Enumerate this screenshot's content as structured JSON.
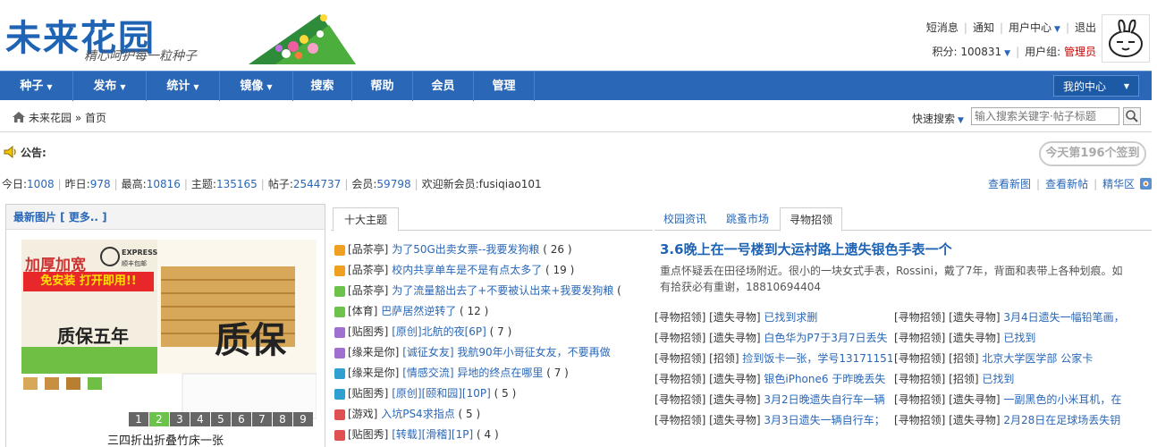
{
  "header": {
    "logo_title": "未来花园",
    "logo_slogan": "精心呵护每一粒种子",
    "links": [
      "短消息",
      "通知",
      "用户中心",
      "退出"
    ],
    "points_label": "积分: 100831",
    "group_label": "用户组:",
    "group_value": "管理员"
  },
  "nav": {
    "items": [
      "种子",
      "发布",
      "统计",
      "镜像",
      "搜索",
      "帮助",
      "会员",
      "管理"
    ],
    "my_center": "我的中心"
  },
  "breadcrumb": {
    "home": "未来花园",
    "sep": "»",
    "current": "首页"
  },
  "quick_search": {
    "label": "快速搜索",
    "placeholder": "输入搜索关键字·帖子标题"
  },
  "notice": {
    "label": "公告:"
  },
  "sign_button": "今天第196个签到",
  "stats": {
    "today_label": "今日:",
    "today": "1008",
    "yesterday_label": "昨日:",
    "yesterday": "978",
    "max_label": "最高:",
    "max": "10816",
    "topics_label": "主题:",
    "topics": "135165",
    "posts_label": "帖子:",
    "posts": "2544737",
    "members_label": "会员:",
    "members": "59798",
    "welcome": "欢迎新会员:fusiqiao101",
    "links": [
      "查看新图",
      "查看新帖",
      "精华区"
    ]
  },
  "latest_images": {
    "title": "最新图片 [ 更多.. ]",
    "caption": "三四折出折叠竹床一张",
    "pages": [
      "1",
      "2",
      "3",
      "4",
      "5",
      "6",
      "7",
      "8",
      "9"
    ],
    "active_page": 2,
    "ad_texts": [
      "加厚加宽",
      "EXPRESS",
      "顺丰包邮",
      "免安装 打开即用!!",
      "质保五年",
      "质保"
    ]
  },
  "top_topics": {
    "tab": "十大主题",
    "items": [
      {
        "forum": "[品茶亭]",
        "title": "为了50G出卖女票--我要发狗粮",
        "count": "( 26 )",
        "color": "#f0a020"
      },
      {
        "forum": "[品茶亭]",
        "title": "校内共享单车是不是有点太多了",
        "count": "( 19 )",
        "color": "#f0a020"
      },
      {
        "forum": "[品茶亭]",
        "title": "为了流量豁出去了+不要被认出来+我要发狗粮",
        "count": "(",
        "color": "#6cc24a"
      },
      {
        "forum": "[体育]",
        "title": "巴萨居然逆转了",
        "count": "( 12 )",
        "color": "#6cc24a"
      },
      {
        "forum": "[贴图秀]",
        "title": "[原创]北航的夜[6P]",
        "count": "( 7 )",
        "color": "#a070d0"
      },
      {
        "forum": "[缘来是你]",
        "title": "[诚征女友] 我航90年小哥征女友，不要再做",
        "count": "",
        "color": "#a070d0"
      },
      {
        "forum": "[缘来是你]",
        "title": "[情感交流] 异地的终点在哪里",
        "count": "( 7 )",
        "color": "#30a0d0"
      },
      {
        "forum": "[贴图秀]",
        "title": "[原创][颐和园][10P]",
        "count": "( 5 )",
        "color": "#30a0d0"
      },
      {
        "forum": "[游戏]",
        "title": "入坑PS4求指点",
        "count": "( 5 )",
        "color": "#e05050"
      },
      {
        "forum": "[贴图秀]",
        "title": "[转载][滑稽][1P]",
        "count": "( 4 )",
        "color": "#e05050"
      }
    ]
  },
  "right_panel": {
    "tabs": [
      "校园资讯",
      "跳蚤市场",
      "寻物招领"
    ],
    "active_tab": 2,
    "headline": "3.6晚上在一号楼到大运村路上遗失银色手表一个",
    "summary": "重点怀疑丢在田径场附近。很小的一块女式手表，Rossini，戴了7年，背面和表带上各种划痕。如有拾获必有重谢，18810694404",
    "rows": [
      [
        {
          "tag": "[寻物招领] [遗失寻物]",
          "title": "已找到求删"
        },
        {
          "tag": "[寻物招领] [遗失寻物]",
          "title": "3月4日遗失一幅铅笔画，"
        }
      ],
      [
        {
          "tag": "[寻物招领] [遗失寻物]",
          "title": "白色华为P7于3月7日丢失"
        },
        {
          "tag": "[寻物招领] [遗失寻物]",
          "title": "已找到"
        }
      ],
      [
        {
          "tag": "[寻物招领] [招领]",
          "title": "捡到饭卡一张，学号13171151"
        },
        {
          "tag": "[寻物招领] [招领]",
          "title": "北京大学医学部 公家卡"
        }
      ],
      [
        {
          "tag": "[寻物招领] [遗失寻物]",
          "title": "银色iPhone6 于昨晚丢失"
        },
        {
          "tag": "[寻物招领] [招领]",
          "title": "已找到"
        }
      ],
      [
        {
          "tag": "[寻物招领] [遗失寻物]",
          "title": "3月2日晚遗失自行车一辆"
        },
        {
          "tag": "[寻物招领] [遗失寻物]",
          "title": "一副黑色的小米耳机，在"
        }
      ],
      [
        {
          "tag": "[寻物招领] [遗失寻物]",
          "title": "3月3日遗失一辆自行车；"
        },
        {
          "tag": "[寻物招领] [遗失寻物]",
          "title": "2月28日在足球场丢失钥"
        }
      ]
    ]
  }
}
